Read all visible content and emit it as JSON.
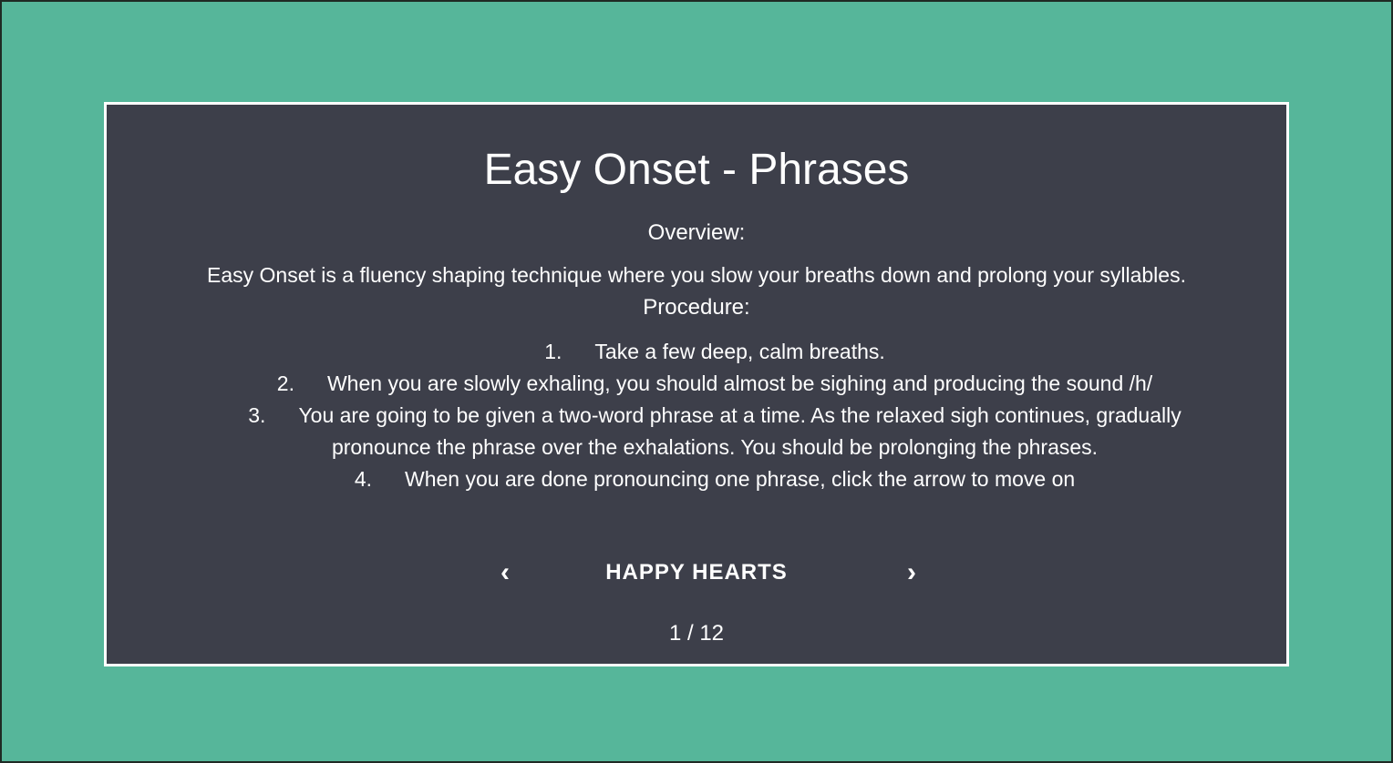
{
  "page": {
    "title": "Easy Onset - Phrases",
    "overview_label": "Overview:",
    "overview_text": "Easy Onset is a fluency shaping technique where you slow your breaths down and prolong your syllables.",
    "procedure_label": "Procedure:",
    "steps": [
      {
        "num": "1.",
        "text": "Take a few deep, calm breaths."
      },
      {
        "num": "2.",
        "text": "When you are slowly exhaling, you should almost be sighing and producing the sound /h/"
      },
      {
        "num": "3.",
        "text": "You are going to be given a two-word phrase at a time. As the relaxed sigh continues, gradually pronounce the phrase over the exhalations. You should be prolonging the phrases."
      },
      {
        "num": "4.",
        "text": "When you are done pronouncing one phrase, click the arrow to move on"
      }
    ]
  },
  "carousel": {
    "prev_icon": "chevron-left",
    "prev_glyph": "‹",
    "next_icon": "chevron-right",
    "next_glyph": "›",
    "phrase": "HAPPY HEARTS",
    "counter": "1 / 12"
  },
  "colors": {
    "background": "#56b69a",
    "card": "#3d3f4a",
    "text": "#ffffff"
  }
}
